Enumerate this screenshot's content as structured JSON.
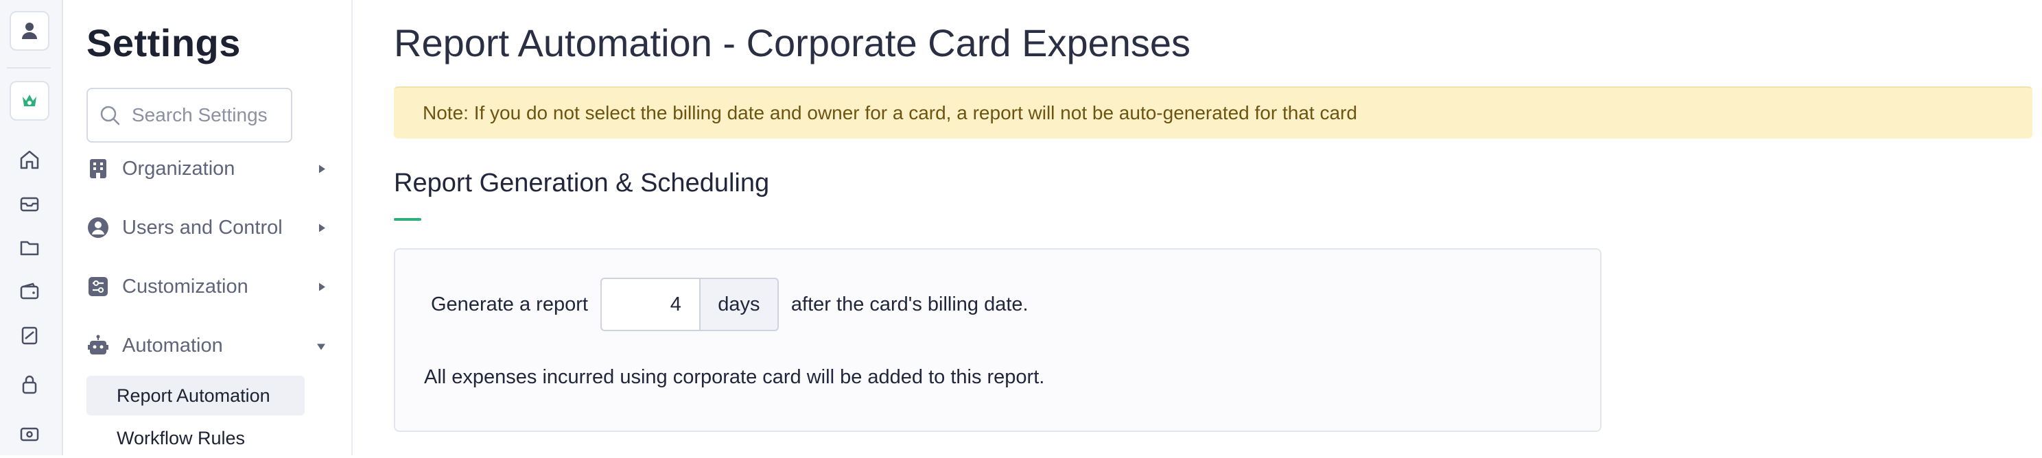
{
  "rail": {
    "items": [
      {
        "icon": "user-icon"
      },
      {
        "icon": "brand-logo-icon",
        "color": "#2eb07c"
      },
      {
        "icon": "home-icon"
      },
      {
        "icon": "inbox-icon"
      },
      {
        "icon": "folder-icon"
      },
      {
        "icon": "wallet-icon"
      },
      {
        "icon": "card-icon"
      },
      {
        "icon": "lock-icon"
      },
      {
        "icon": "cash-icon"
      }
    ]
  },
  "sidebar": {
    "title": "Settings",
    "search_placeholder": "Search Settings",
    "items": [
      {
        "label": "Organization",
        "icon": "building-icon",
        "expanded": false
      },
      {
        "label": "Users and Control",
        "icon": "user-circle-icon",
        "expanded": false
      },
      {
        "label": "Customization",
        "icon": "sliders-icon",
        "expanded": false
      },
      {
        "label": "Automation",
        "icon": "robot-icon",
        "expanded": true
      }
    ],
    "subitems": [
      {
        "label": "Report Automation",
        "active": true
      },
      {
        "label": "Workflow Rules",
        "active": false
      }
    ]
  },
  "main": {
    "title": "Report Automation - Corporate Card Expenses",
    "note": "Note: If you do not select the billing date and owner for a card, a report will not be auto-generated for that card",
    "section_title": "Report Generation & Scheduling",
    "generate": {
      "prefix": "Generate a report",
      "value": "4",
      "unit": "days",
      "suffix": "after the card's billing date."
    },
    "card_note": "All expenses incurred using corporate card will be added to this report."
  },
  "colors": {
    "accent": "#2eb07c",
    "note_bg": "#fdf1c8",
    "note_text": "#6d5410"
  }
}
